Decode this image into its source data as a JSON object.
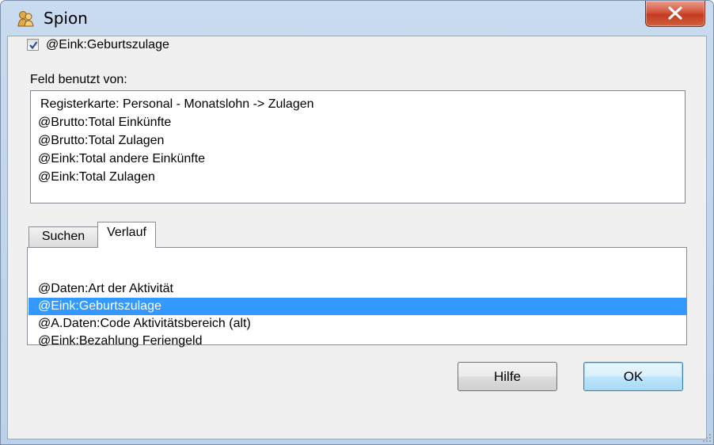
{
  "window": {
    "title": "Spion",
    "close_glyph": "X"
  },
  "checkbox": {
    "label": "@Eink:Geburtszulage",
    "checked": true
  },
  "used_by": {
    "label": "Feld benutzt von:",
    "items": [
      "Registerkarte: Personal - Monatslohn -> Zulagen",
      "@Brutto:Total Einkünfte",
      "@Brutto:Total Zulagen",
      "@Eink:Total andere Einkünfte",
      "@Eink:Total Zulagen"
    ]
  },
  "tabs": {
    "items": [
      "Suchen",
      "Verlauf"
    ],
    "active": "Verlauf"
  },
  "history": {
    "items": [
      "@Daten:Art der Aktivität",
      "@Eink:Geburtszulage",
      "@A.Daten:Code Aktivitätsbereich (alt)",
      "@Eink:Bezahlung Feriengeld"
    ],
    "selected_index": 1
  },
  "buttons": {
    "help": "Hilfe",
    "ok": "OK"
  },
  "colors": {
    "selection": "#3399ff",
    "close_button": "#c33b20"
  },
  "icons": {
    "title": "spy-figure-icon",
    "close": "close-icon",
    "checkmark": "checkmark-icon",
    "grip": "resize-grip-icon"
  }
}
